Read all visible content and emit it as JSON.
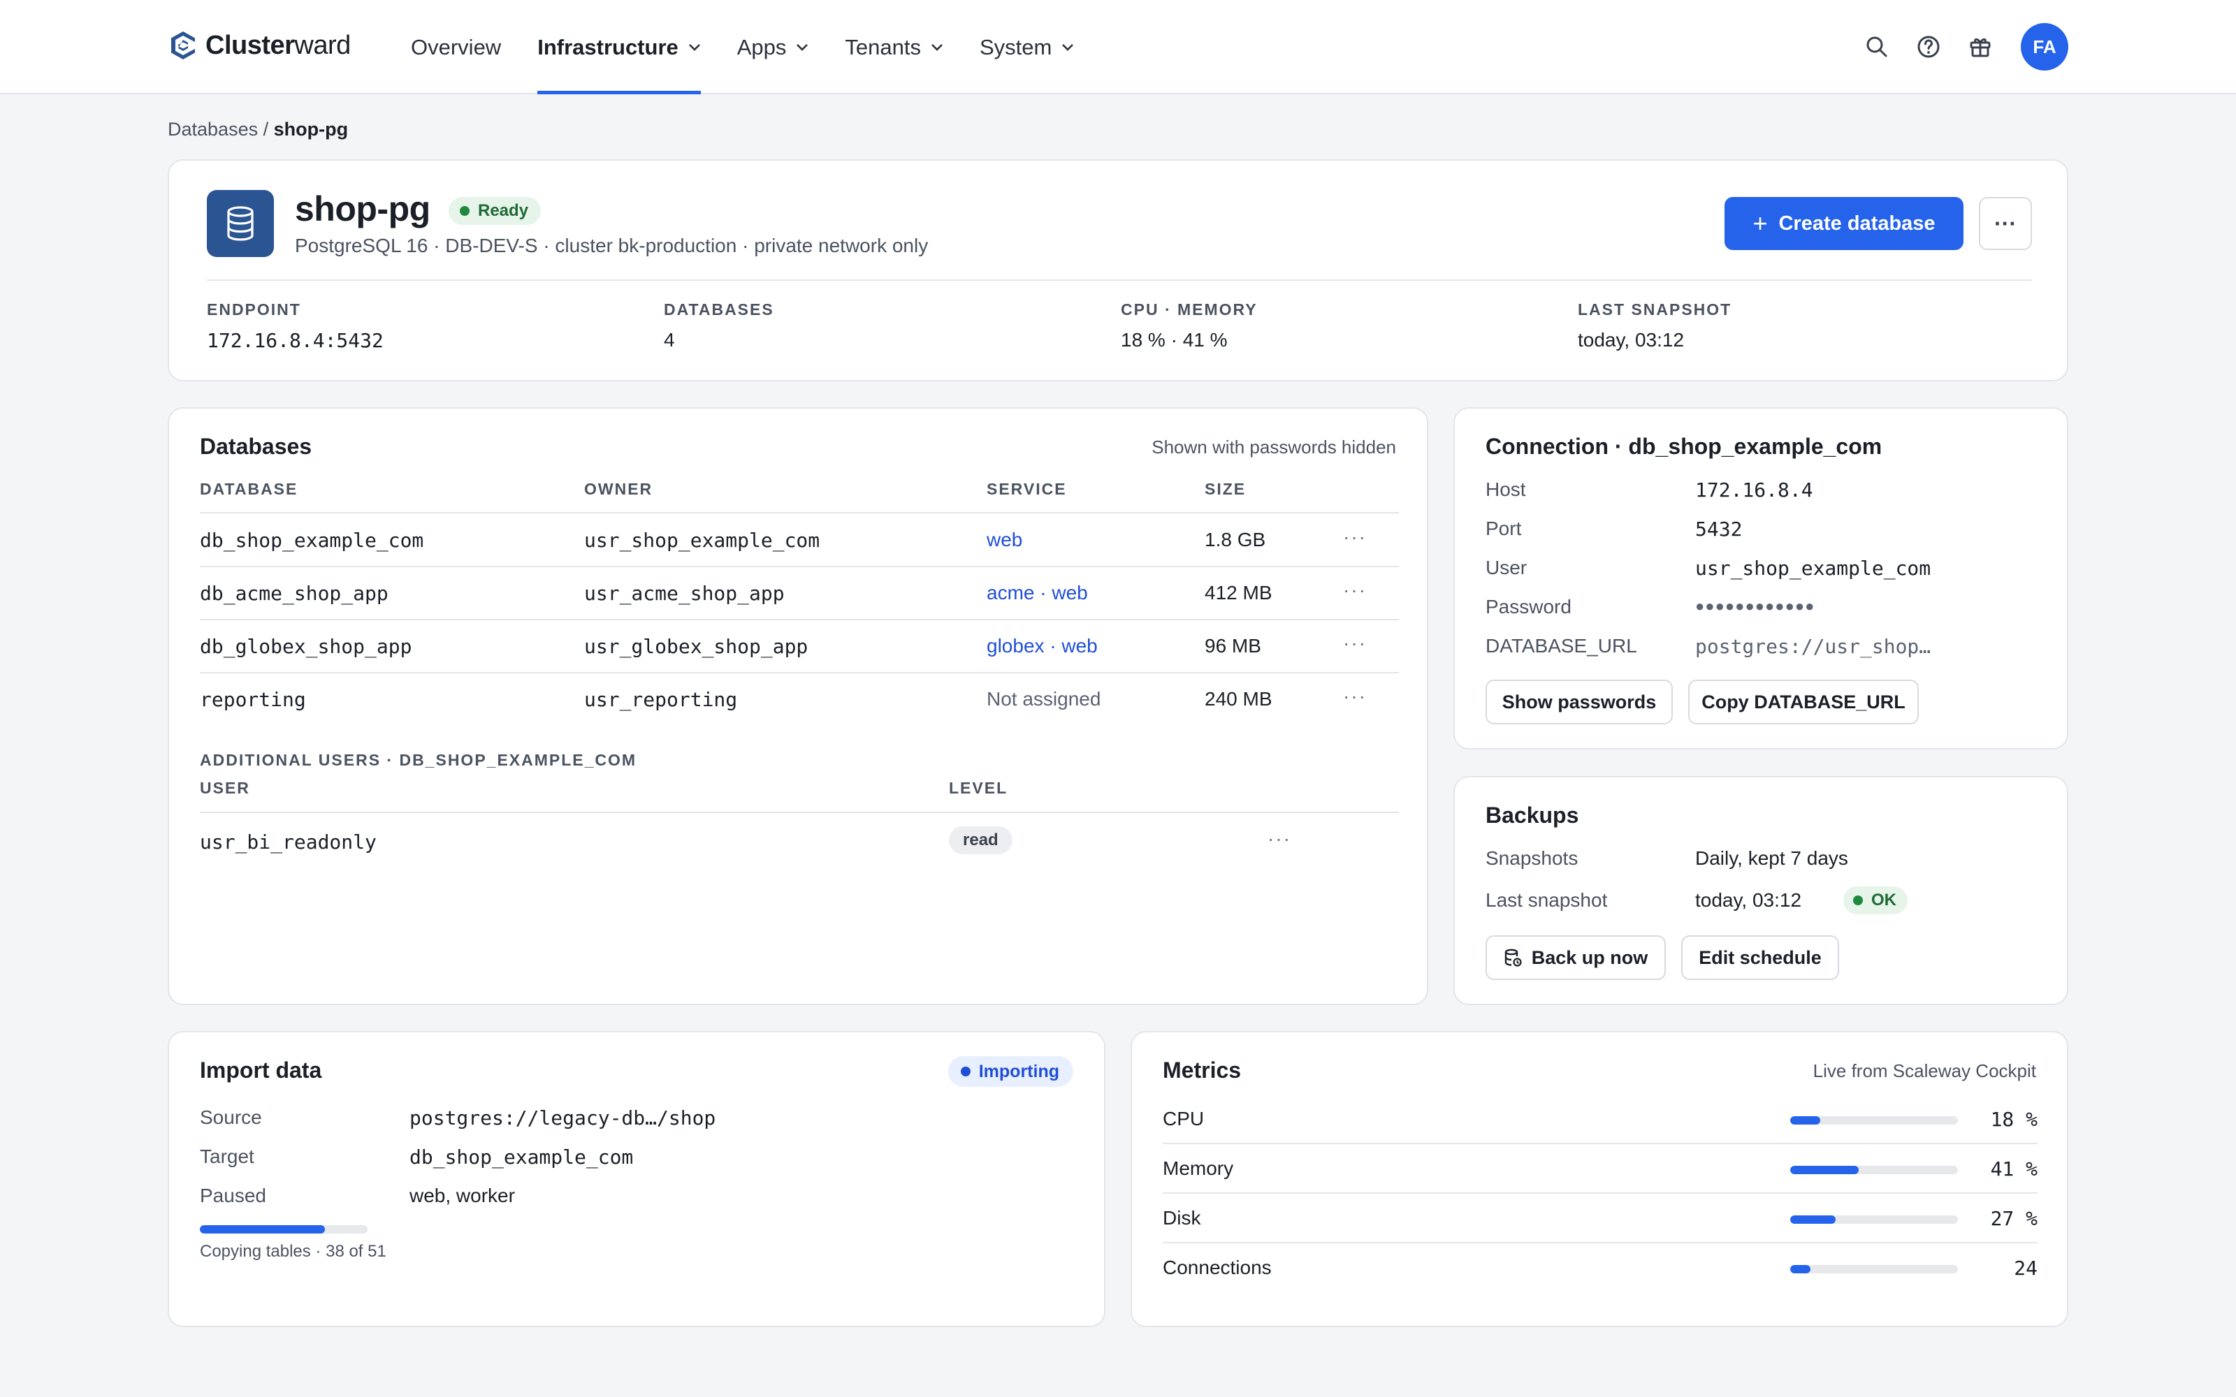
{
  "brand": {
    "bold": "Cluster",
    "rest": "ward"
  },
  "nav": {
    "items": [
      {
        "label": "Overview",
        "dropdown": false,
        "active": false
      },
      {
        "label": "Infrastructure",
        "dropdown": true,
        "active": true
      },
      {
        "label": "Apps",
        "dropdown": true,
        "active": false
      },
      {
        "label": "Tenants",
        "dropdown": true,
        "active": false
      },
      {
        "label": "System",
        "dropdown": true,
        "active": false
      }
    ],
    "icons": [
      "search-icon",
      "help-icon",
      "gift-icon"
    ],
    "avatar_initials": "FA"
  },
  "breadcrumb": {
    "parent": "Databases",
    "separator": " / ",
    "current": "shop-pg"
  },
  "header": {
    "title": "shop-pg",
    "status": "Ready",
    "subtitle": "PostgreSQL 16 · DB-DEV-S · cluster bk-production · private network only",
    "create_button": "Create database",
    "more_button": "···",
    "stats": [
      {
        "label": "ENDPOINT",
        "value": "172.16.8.4:5432",
        "mono": true
      },
      {
        "label": "DATABASES",
        "value": "4",
        "mono": false
      },
      {
        "label": "CPU · MEMORY",
        "value": "18 % · 41 %",
        "mono": false
      },
      {
        "label": "LAST SNAPSHOT",
        "value": "today, 03:12",
        "mono": false
      }
    ]
  },
  "databases": {
    "title": "Databases",
    "note": "Shown with passwords hidden",
    "columns": [
      "DATABASE",
      "OWNER",
      "SERVICE",
      "SIZE"
    ],
    "rows": [
      {
        "database": "db_shop_example_com",
        "owner": "usr_shop_example_com",
        "service": "web",
        "service_type": "link",
        "size": "1.8 GB"
      },
      {
        "database": "db_acme_shop_app",
        "owner": "usr_acme_shop_app",
        "service": "acme · web",
        "service_type": "link",
        "size": "412 MB"
      },
      {
        "database": "db_globex_shop_app",
        "owner": "usr_globex_shop_app",
        "service": "globex · web",
        "service_type": "link",
        "size": "96 MB"
      },
      {
        "database": "reporting",
        "owner": "usr_reporting",
        "service": "Not assigned",
        "service_type": "muted",
        "size": "240 MB"
      }
    ],
    "row_more": "···",
    "additional": {
      "title": "ADDITIONAL USERS · DB_SHOP_EXAMPLE_COM",
      "columns": [
        "USER",
        "LEVEL"
      ],
      "rows": [
        {
          "user": "usr_bi_readonly",
          "level": "read"
        }
      ]
    }
  },
  "connection": {
    "title": "Connection · db_shop_example_com",
    "fields": [
      {
        "key": "Host",
        "value": "172.16.8.4"
      },
      {
        "key": "Port",
        "value": "5432"
      },
      {
        "key": "User",
        "value": "usr_shop_example_com"
      },
      {
        "key": "Password",
        "value": "●●●●●●●●●●●●"
      },
      {
        "key": "DATABASE_URL",
        "value": "postgres://usr_shop…"
      }
    ],
    "show_passwords": "Show passwords",
    "copy_url": "Copy DATABASE_URL"
  },
  "backups": {
    "title": "Backups",
    "snapshots_key": "Snapshots",
    "snapshots_value": "Daily, kept 7 days",
    "last_key": "Last snapshot",
    "last_value": "today, 03:12",
    "last_status": "OK",
    "backup_now": "Back up now",
    "edit_schedule": "Edit schedule"
  },
  "import": {
    "title": "Import data",
    "status": "Importing",
    "fields": [
      {
        "key": "Source",
        "value": "postgres://legacy-db…/shop",
        "mono": true
      },
      {
        "key": "Target",
        "value": "db_shop_example_com",
        "mono": true
      },
      {
        "key": "Paused",
        "value": "web, worker",
        "mono": false
      }
    ],
    "progress_fraction": 0.745,
    "caption": "Copying tables · 38 of 51"
  },
  "metrics": {
    "title": "Metrics",
    "note": "Live from Scaleway Cockpit",
    "rows": [
      {
        "label": "CPU",
        "value": "18 %",
        "fraction": 0.18
      },
      {
        "label": "Memory",
        "value": "41 %",
        "fraction": 0.41
      },
      {
        "label": "Disk",
        "value": "27 %",
        "fraction": 0.27
      },
      {
        "label": "Connections",
        "value": "24",
        "fraction": 0.12
      }
    ]
  },
  "colors": {
    "accent": "#2563eb",
    "link": "#1f4fd6",
    "db_icon_bg": "#2b5592",
    "ready_bg": "#e6f4ea",
    "ready_text": "#1f6b36"
  }
}
